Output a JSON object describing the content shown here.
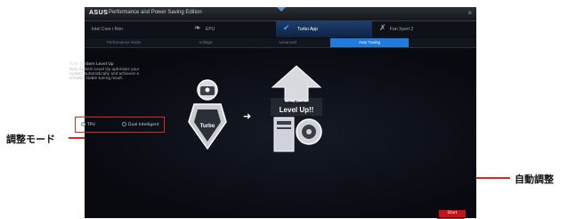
{
  "callouts": {
    "tuning_mode": "調整モード",
    "auto_tuning": "自動調整"
  },
  "window": {
    "brand": "ASUS",
    "title": "Performance and Power Saving Edition",
    "close_symbol": "×"
  },
  "tabs": [
    {
      "label": "Intel Core i-Nnn",
      "icon": "chip-icon",
      "glyph": "▦"
    },
    {
      "label": "EPU",
      "icon": "leaf-icon",
      "glyph": "❧"
    },
    {
      "label": "Turbo App",
      "icon": "check-wing-icon",
      "glyph": "✔"
    },
    {
      "label": "Fan Xpert 2",
      "icon": "fan-icon",
      "glyph": "✗"
    }
  ],
  "subtabs": [
    "Performance Mode",
    "Voltage",
    "Advanced",
    "Auto Tuning"
  ],
  "description": {
    "title": "Auto System Level Up",
    "body": "Auto System Level Up optimizes your system automatically and achieves a smooth, stable tuning result."
  },
  "modes": {
    "options": [
      "TPU",
      "Dual Intelligent"
    ],
    "selected": "TPU"
  },
  "illustration": {
    "badge_label": "Turbo",
    "banner": "Auto System",
    "banner_line2": "Level Up!!"
  },
  "start_button": "Start",
  "colors": {
    "callout": "#e0261d",
    "active_tab": "#1f7be0",
    "start_button": "#c6121a"
  }
}
